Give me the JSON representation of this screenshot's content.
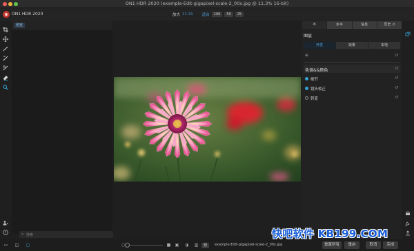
{
  "window": {
    "title": "ON1 HDR 2020 (example-Edit-gigapixel-scale-2_00x.jpg @ 11.3% 16-bit)"
  },
  "toolbar": {
    "app_name": "ON1 HDR 2020",
    "zoom_label": "放大",
    "zoom_value": "11.31",
    "fit_label": "适合",
    "zoom_presets": [
      "100",
      "50",
      "25"
    ]
  },
  "left_panel": {
    "tab_label": "预览",
    "search_placeholder": "搜索"
  },
  "tools": [
    "crop-icon",
    "move-icon",
    "brush-icon",
    "adjust-brush-icon",
    "masking-brush-icon",
    "eraser-icon",
    "zoom-icon"
  ],
  "right_panel": {
    "tabs": [
      {
        "label": "不",
        "selected": true
      },
      {
        "label": "水平",
        "selected": false
      },
      {
        "label": "信息",
        "selected": false
      },
      {
        "label": "历史 ↺",
        "selected": false
      }
    ],
    "layers_title": "图层",
    "sub_tabs": [
      {
        "label": "开发",
        "selected": true
      },
      {
        "label": "效果",
        "selected": false
      },
      {
        "label": "本地",
        "selected": false
      }
    ],
    "tone_color_title": "色调&&颜色",
    "items": [
      {
        "label": "细节",
        "active": true
      },
      {
        "label": "镜头校正",
        "active": true
      },
      {
        "label": "转变",
        "active": false
      }
    ]
  },
  "bottom_bar": {
    "file_button": "预",
    "file_name": "example-Edit-gigapixel-scale-2_00x.jpg",
    "buttons": [
      "重置所有",
      "重启",
      "取消",
      "完成"
    ]
  },
  "watermark": "快吧软件 KB199.COM",
  "colors": {
    "accent": "#37a6d9",
    "background": "#1f1f1f",
    "panel": "#222222"
  }
}
